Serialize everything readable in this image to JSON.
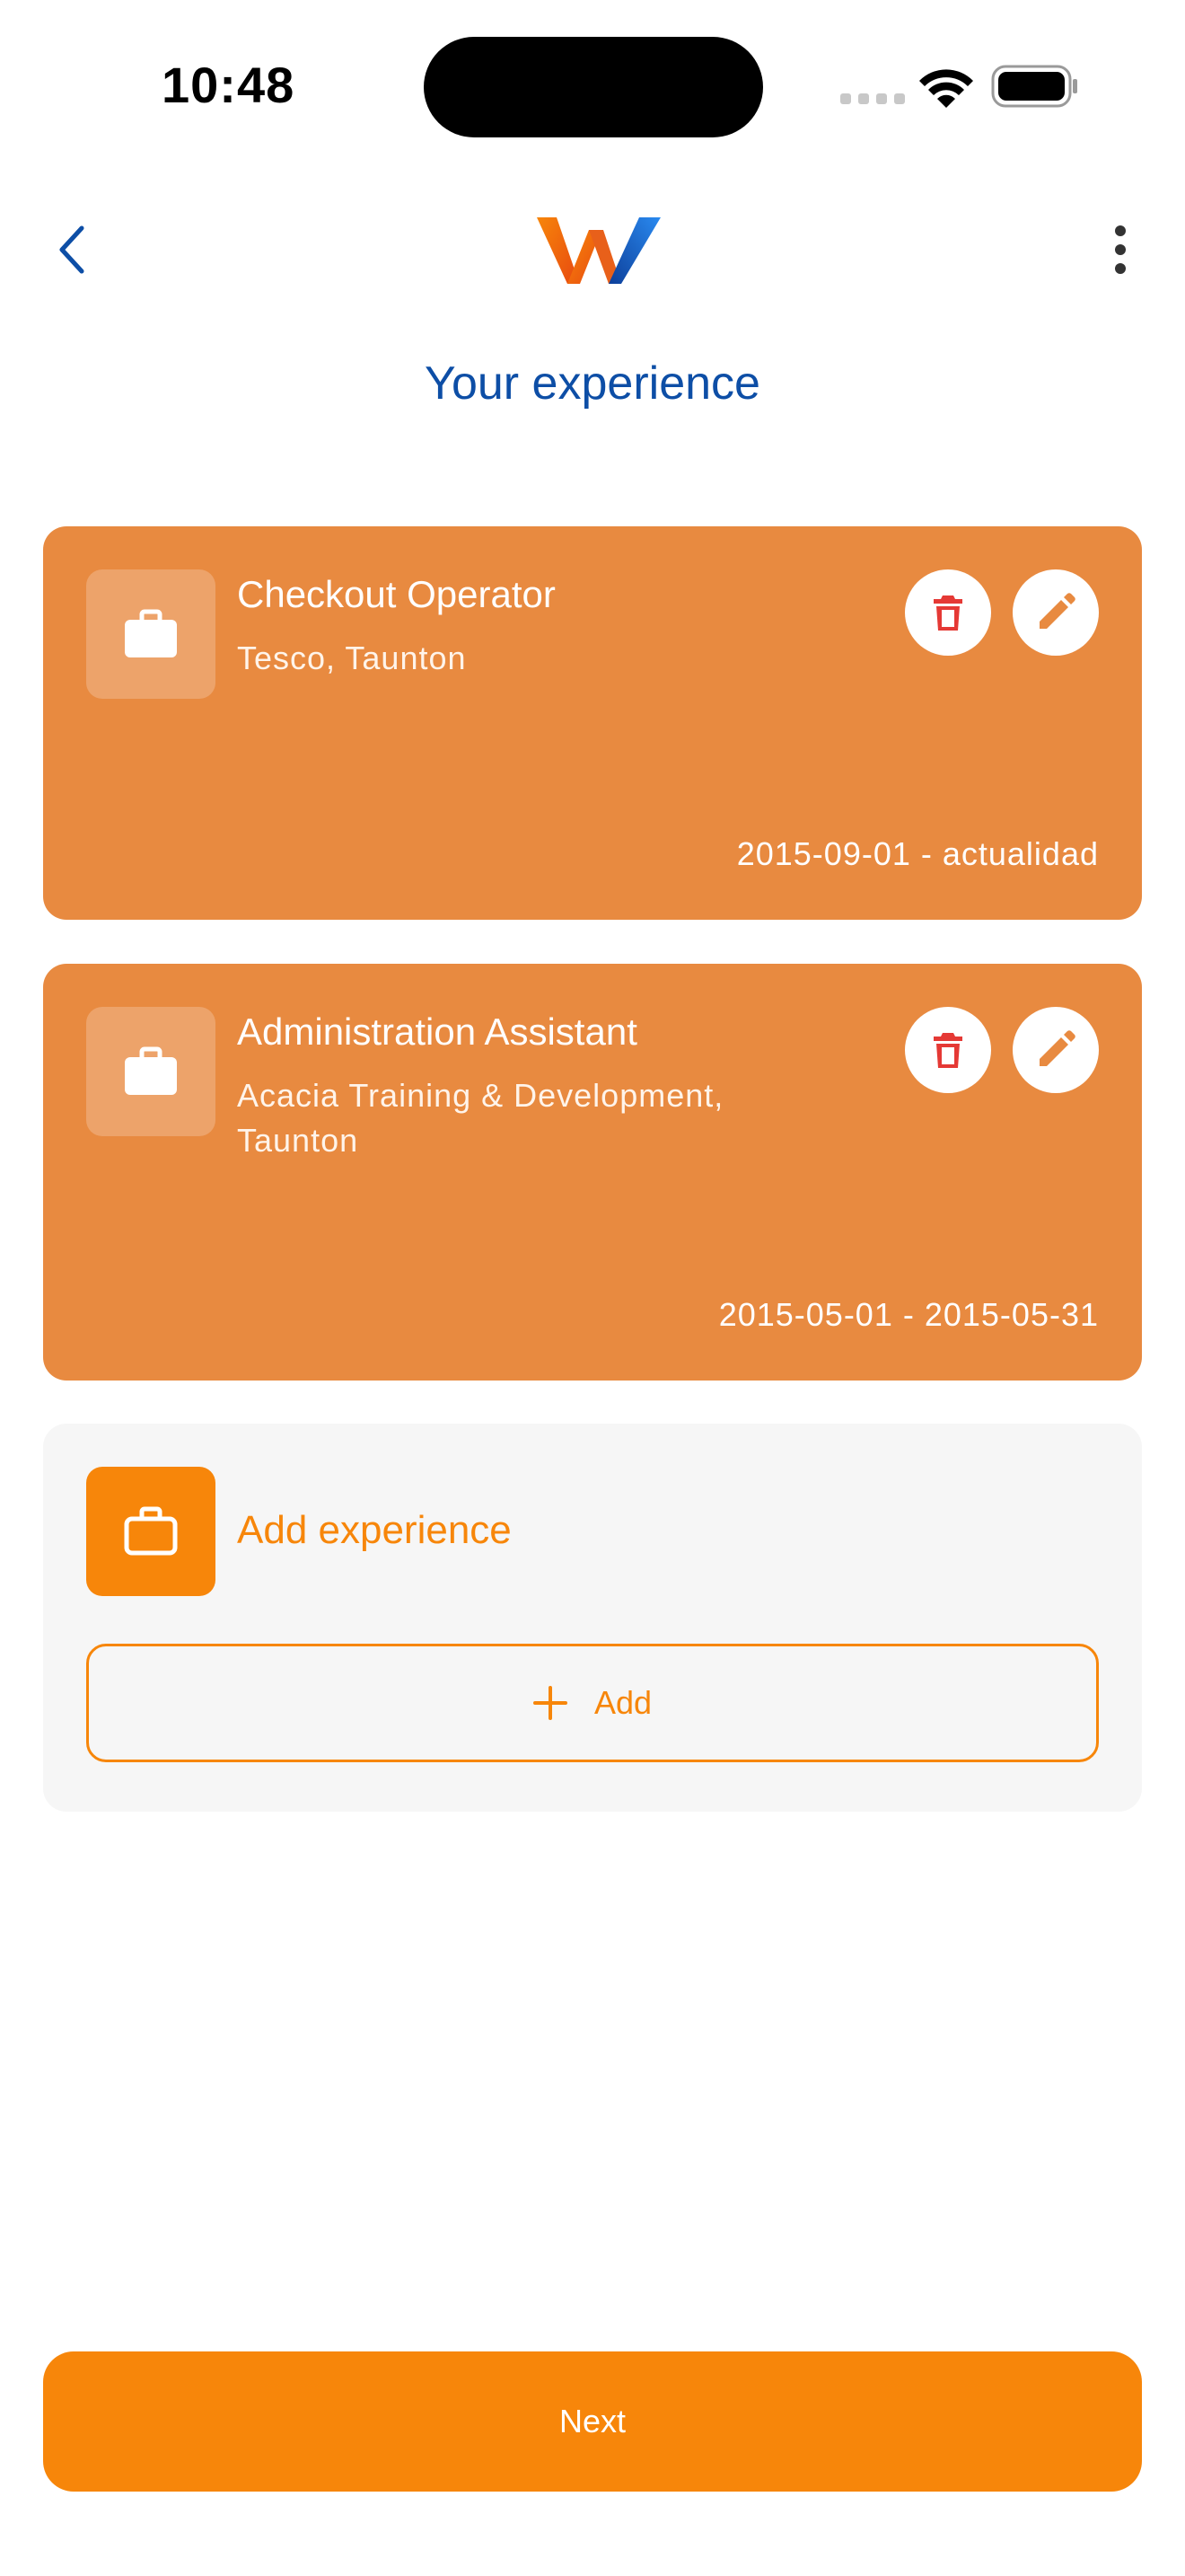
{
  "status_bar": {
    "time": "10:48"
  },
  "header": {
    "logo_icon": "w-logo-icon",
    "title": "Your experience"
  },
  "colors": {
    "accent": "#f7860a",
    "card": "#e88a40",
    "title_blue": "#0d4ea6",
    "delete_red": "#e53935",
    "panel_bg": "#f6f6f6"
  },
  "experiences": [
    {
      "title": "Checkout Operator",
      "company": "Tesco, Taunton",
      "dates": "2015-09-01 - actualidad",
      "icon": "briefcase-icon"
    },
    {
      "title": "Administration Assistant",
      "company": "Acacia Training & Development, Taunton",
      "dates": "2015-05-01 - 2015-05-31",
      "icon": "briefcase-icon"
    }
  ],
  "add_section": {
    "heading": "Add experience",
    "button_label": "Add"
  },
  "footer": {
    "next_label": "Next"
  }
}
